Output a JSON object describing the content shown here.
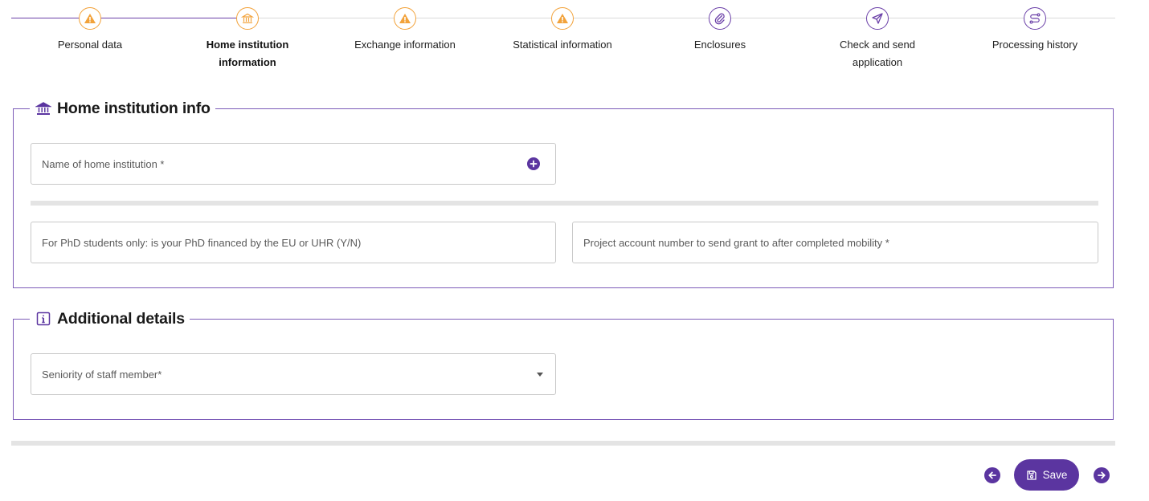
{
  "stepper": {
    "steps": [
      {
        "label": "Personal data",
        "icon": "warning-icon",
        "status": "warning"
      },
      {
        "label": "Home institution information",
        "icon": "institution-icon",
        "status": "active"
      },
      {
        "label": "Exchange information",
        "icon": "warning-icon",
        "status": "warning"
      },
      {
        "label": "Statistical information",
        "icon": "warning-icon",
        "status": "warning"
      },
      {
        "label": "Enclosures",
        "icon": "paperclip-icon",
        "status": "pending"
      },
      {
        "label": "Check and send application",
        "icon": "send-icon",
        "status": "pending"
      },
      {
        "label": "Processing history",
        "icon": "route-icon",
        "status": "pending"
      }
    ]
  },
  "home_institution": {
    "title": "Home institution info",
    "icon": "institution-icon",
    "name_field": {
      "placeholder": "Name of home institution *",
      "value": ""
    },
    "phd_field": {
      "placeholder": "For PhD students only: is your PhD financed by the EU or UHR (Y/N)",
      "value": ""
    },
    "account_field": {
      "placeholder": "Project account number to send grant to after completed mobility *",
      "value": ""
    }
  },
  "additional_details": {
    "title": "Additional details",
    "icon": "info-icon",
    "seniority_select": {
      "placeholder": "Seniority of staff member*",
      "value": ""
    }
  },
  "footer": {
    "save_label": "Save"
  },
  "colors": {
    "accent": "#5b35a0",
    "border": "#7c5cb8",
    "warning": "#f2a23a"
  }
}
